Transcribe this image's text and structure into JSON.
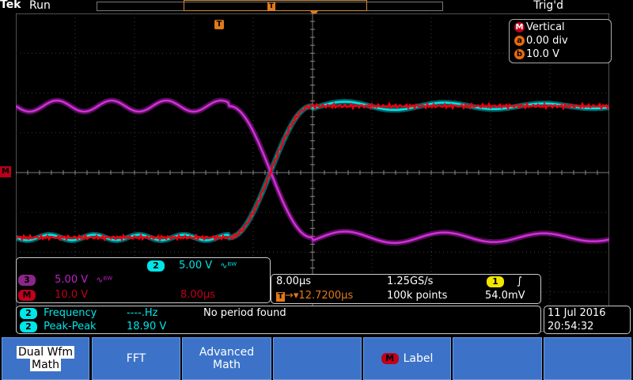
{
  "status": {
    "brand": "Tek",
    "state": "Run",
    "trigger_status": "Trig'd"
  },
  "record_bar": {
    "trigger_letter": "T"
  },
  "trigger_marker_letter": "T",
  "math_marker_letter": "M",
  "vertical_box": {
    "badge": "M",
    "title": "Vertical",
    "row_a_badge": "a",
    "row_a_value": "0.00 div",
    "row_b_badge": "b",
    "row_b_value": "10.0 V"
  },
  "channels": {
    "ch2": {
      "number": "2",
      "scale": "5.00 V",
      "bw_symbol": "∿ᴮᵂ"
    },
    "ch3": {
      "number": "3",
      "scale": "5.00 V",
      "bw_symbol": "∿ᴮᵂ"
    },
    "math": {
      "badge": "M",
      "scale": "10.0 V",
      "time": "8.00µs"
    }
  },
  "horizontal": {
    "timebase": "8.00µs",
    "sample_rate": "1.25GS/s",
    "trigger_channel": "1",
    "trigger_slope": "∫",
    "trigger_badge": "T",
    "position": "12.7200µs",
    "record_length": "100k points",
    "trigger_level": "54.0mV"
  },
  "measurements": [
    {
      "channel": "2",
      "label": "Frequency",
      "value": "----.Hz",
      "note": "No period found"
    },
    {
      "channel": "2",
      "label": "Peak-Peak",
      "value": "18.90 V",
      "note": ""
    }
  ],
  "datetime": {
    "date": "11 Jul  2016",
    "time": "20:54:32"
  },
  "softkeys": [
    {
      "line1": "Dual Wfm",
      "line2": "Math"
    },
    {
      "line1": "FFT",
      "line2": ""
    },
    {
      "line1": "Advanced",
      "line2": "Math"
    },
    {
      "badge": "M",
      "line1": "Label"
    }
  ],
  "colors": {
    "ch2": "#00e5e8",
    "ch3": "#c020c8",
    "math": "#e00010",
    "trigger": "#e07a1a",
    "softkey": "#3c73c8"
  }
}
